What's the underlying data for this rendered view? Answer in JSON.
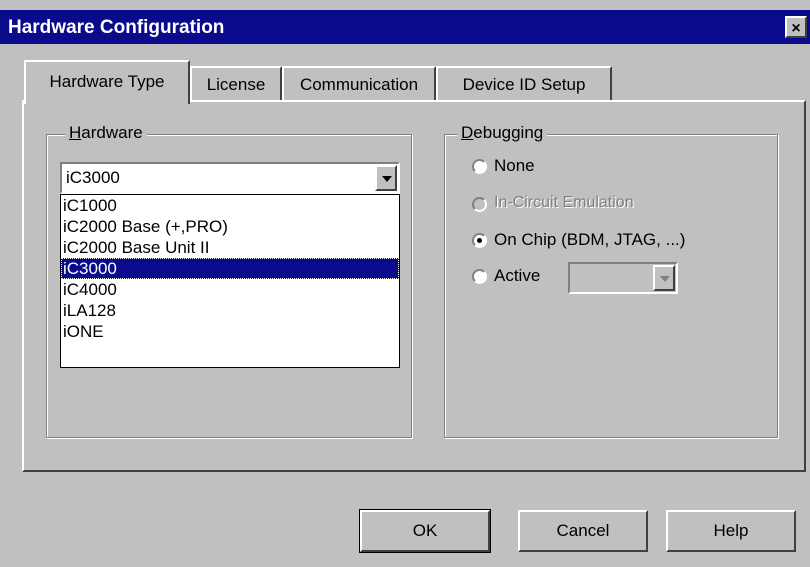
{
  "window": {
    "title": "Hardware Configuration",
    "close_glyph": "×"
  },
  "tabs": [
    {
      "label": "Hardware Type",
      "active": true
    },
    {
      "label": "License",
      "active": false
    },
    {
      "label": "Communication",
      "active": false
    },
    {
      "label": "Device ID Setup",
      "active": false
    }
  ],
  "hardware": {
    "group_label_mnemonic": "H",
    "group_label_rest": "ardware",
    "selected": "iC3000",
    "options": [
      "iC1000",
      "iC2000 Base (+,PRO)",
      "iC2000 Base Unit II",
      "iC3000",
      "iC4000",
      "iLA128",
      "iONE"
    ]
  },
  "debugging": {
    "group_label_mnemonic": "D",
    "group_label_rest": "ebugging",
    "options": [
      {
        "label": "None",
        "checked": false,
        "disabled": false
      },
      {
        "label": "In-Circuit Emulation",
        "checked": false,
        "disabled": true
      },
      {
        "label": "On Chip (BDM, JTAG, ...)",
        "checked": true,
        "disabled": false
      },
      {
        "label": "Active",
        "checked": false,
        "disabled": false
      }
    ],
    "active_combo_value": ""
  },
  "buttons": {
    "ok": "OK",
    "cancel": "Cancel",
    "help": "Help"
  },
  "colors": {
    "titlebar": "#0a0a8c",
    "face": "#c0c0c0",
    "selection": "#0a0a8c"
  }
}
